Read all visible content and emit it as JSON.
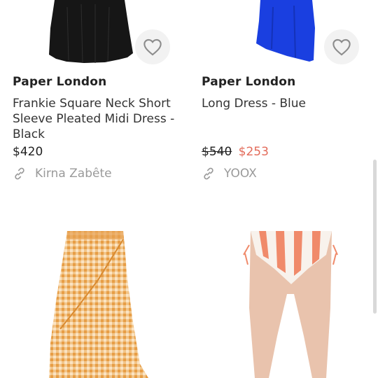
{
  "products": [
    {
      "brand": "Paper London",
      "name": "Frankie Square Neck Short Sleeve Pleated Midi Dress - Black",
      "price": "$420",
      "retailer": "Kirna Zabête",
      "image_icon": "black-dress-image",
      "favorite_icon": "heart-icon"
    },
    {
      "brand": "Paper London",
      "name": "Long Dress - Blue",
      "price_original": "$540",
      "price_sale": "$253",
      "retailer": "YOOX",
      "image_icon": "blue-dress-image",
      "favorite_icon": "heart-icon"
    },
    {
      "image_icon": "gingham-skirt-image"
    },
    {
      "image_icon": "striped-bikini-bottom-image"
    }
  ],
  "colors": {
    "sale": "#e36b5a",
    "muted": "#9a9a9a",
    "blue_dress": "#1a3fe0",
    "gingham": "#f0b25a"
  }
}
